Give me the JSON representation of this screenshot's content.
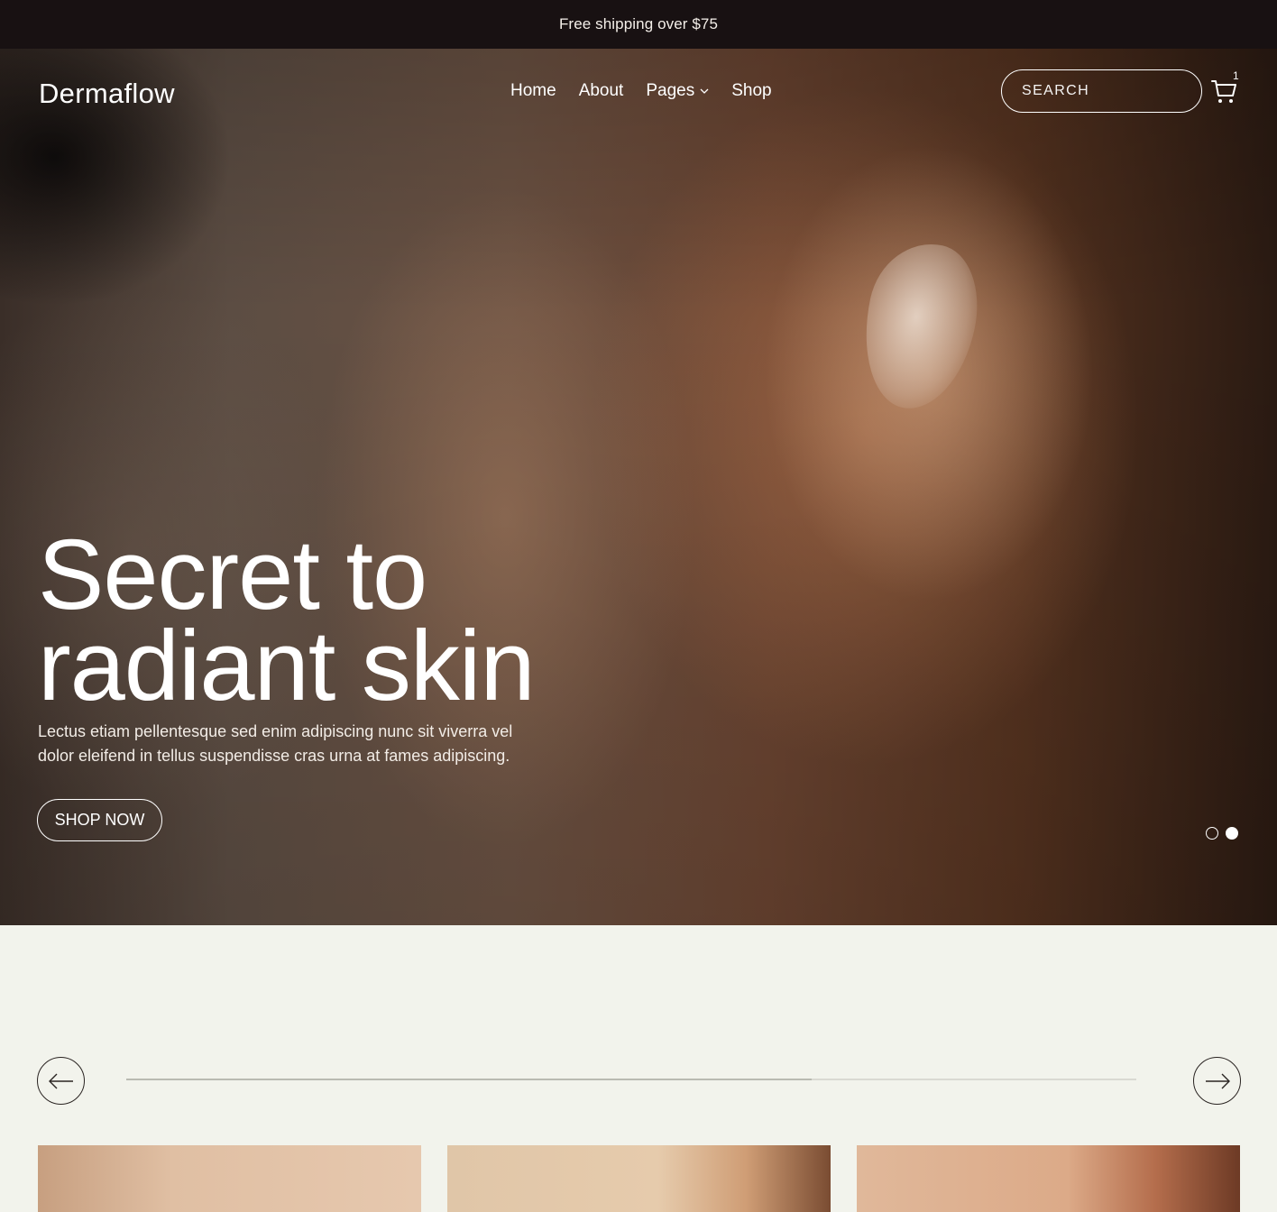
{
  "announcement": "Free shipping over $75",
  "header": {
    "logo": "Dermaflow",
    "nav": [
      {
        "label": "Home"
      },
      {
        "label": "About"
      },
      {
        "label": "Pages",
        "icon": "chevron-down-icon"
      },
      {
        "label": "Shop"
      }
    ],
    "search": {
      "placeholder": "SEARCH",
      "icon": "search-icon"
    },
    "cart": {
      "icon": "cart-icon",
      "count": "1"
    }
  },
  "hero": {
    "title_line1": "Secret to",
    "title_line2": "radiant skin",
    "subtitle": "Lectus etiam pellentesque sed enim adipiscing nunc sit viverra vel dolor eleifend in tellus suspendisse cras urna at fames adipiscing.",
    "cta": "SHOP NOW",
    "slides_total": 2,
    "active_slide": 2
  },
  "carousel": {
    "prev_icon": "arrow-left-icon",
    "next_icon": "arrow-right-icon",
    "cards_visible": 3
  },
  "colors": {
    "topbar_bg": "#181112",
    "page_bg": "#f2f3ec",
    "text_dark": "#2a2422",
    "white": "#ffffff"
  }
}
